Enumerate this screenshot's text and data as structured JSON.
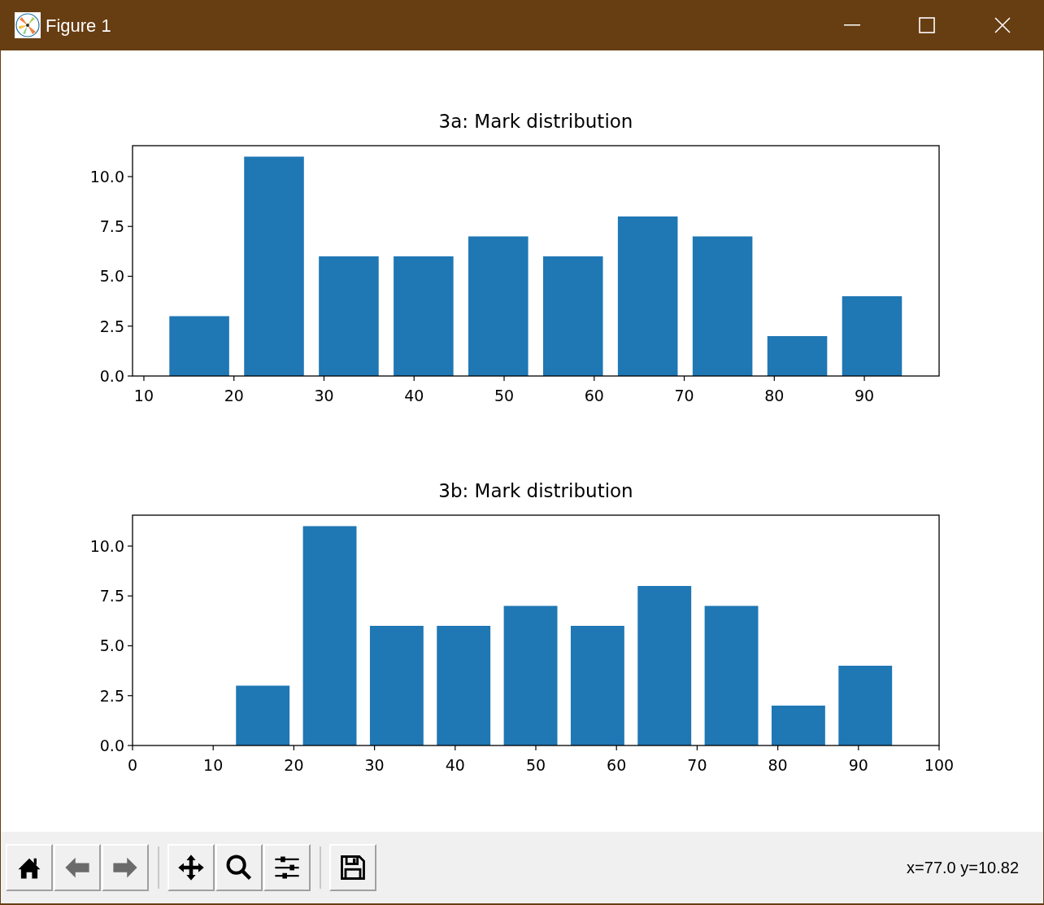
{
  "window": {
    "title": "Figure 1"
  },
  "figures": [
    {
      "chart_data": {
        "type": "bar",
        "title": "3a: Mark distribution",
        "x": [
          16.15,
          24.45,
          32.75,
          41.05,
          49.35,
          57.65,
          65.95,
          74.25,
          82.55,
          90.85
        ],
        "values": [
          3,
          11,
          6,
          6,
          7,
          6,
          8,
          7,
          2,
          4
        ],
        "xlim": [
          8.74,
          98.3
        ],
        "ylim": [
          0,
          11.55
        ],
        "xticks": [
          10,
          20,
          30,
          40,
          50,
          60,
          70,
          80,
          90
        ],
        "yticks": [
          {
            "value": 0,
            "label": "0.0"
          },
          {
            "value": 2.5,
            "label": "2.5"
          },
          {
            "value": 5,
            "label": "5.0"
          },
          {
            "value": 7.5,
            "label": "7.5"
          },
          {
            "value": 10,
            "label": "10.0"
          }
        ]
      }
    },
    {
      "chart_data": {
        "type": "bar",
        "title": "3b: Mark distribution",
        "x": [
          16.15,
          24.45,
          32.75,
          41.05,
          49.35,
          57.65,
          65.95,
          74.25,
          82.55,
          90.85
        ],
        "values": [
          3,
          11,
          6,
          6,
          7,
          6,
          8,
          7,
          2,
          4
        ],
        "xlim": [
          0,
          100
        ],
        "ylim": [
          0,
          11.55
        ],
        "xticks": [
          0,
          10,
          20,
          30,
          40,
          50,
          60,
          70,
          80,
          90,
          100
        ],
        "yticks": [
          {
            "value": 0,
            "label": "0.0"
          },
          {
            "value": 2.5,
            "label": "2.5"
          },
          {
            "value": 5,
            "label": "5.0"
          },
          {
            "value": 7.5,
            "label": "7.5"
          },
          {
            "value": 10,
            "label": "10.0"
          }
        ]
      }
    }
  ],
  "toolbar": {
    "groups": [
      [
        {
          "kind": "home",
          "disabled": false
        },
        {
          "kind": "back",
          "disabled": true
        },
        {
          "kind": "forward",
          "disabled": true
        }
      ],
      [
        {
          "kind": "pan",
          "disabled": false
        },
        {
          "kind": "zoom",
          "disabled": false
        },
        {
          "kind": "configure",
          "disabled": false
        }
      ],
      [
        {
          "kind": "save",
          "disabled": false
        }
      ]
    ],
    "status": "x=77.0 y=10.82"
  }
}
